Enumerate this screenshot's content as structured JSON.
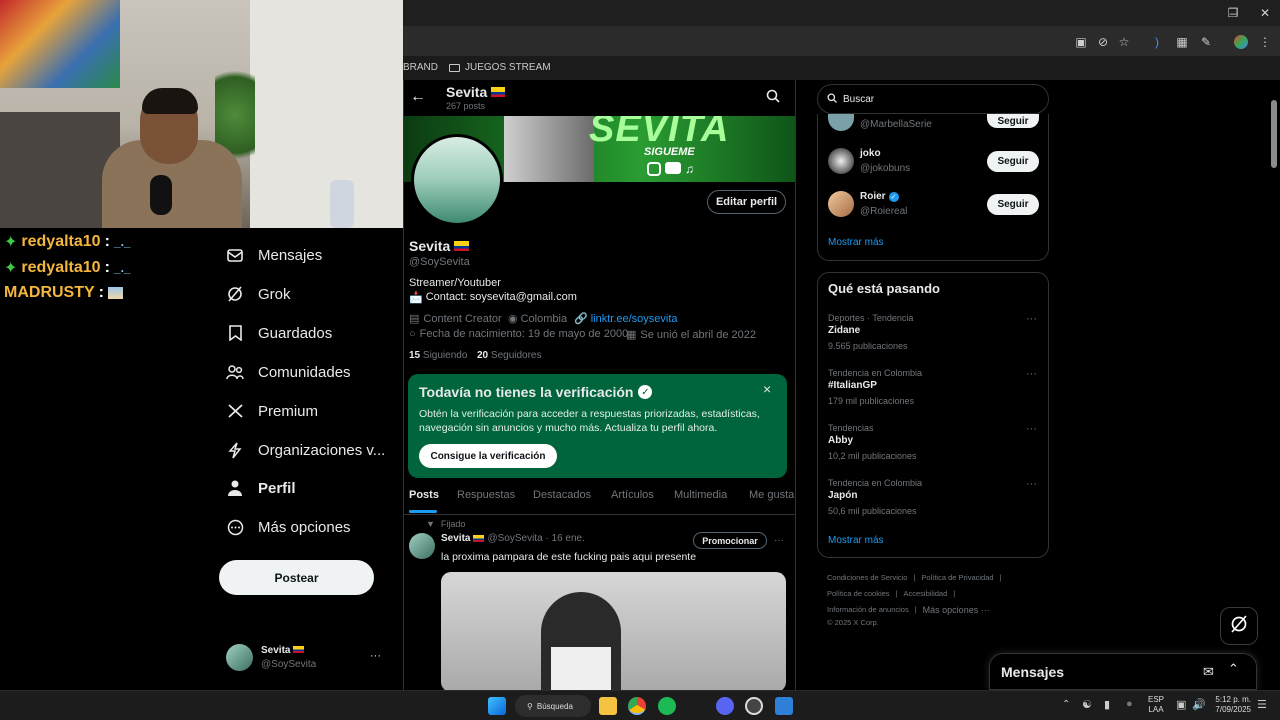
{
  "browser": {
    "bookmarks": [
      {
        "label": "BRAND"
      },
      {
        "label": "JUEGOS STREAM"
      }
    ]
  },
  "chat": [
    {
      "user": "redyalta10",
      "sep": ":",
      "msg": "_._",
      "color": "#f4b63f"
    },
    {
      "user": "redyalta10",
      "sep": ":",
      "msg": "_._",
      "color": "#f4b63f"
    },
    {
      "user": "MADRUSTY",
      "sep": ":",
      "msg": "",
      "color": "#f4b63f"
    }
  ],
  "nav": {
    "items": [
      {
        "label": "Mensajes",
        "icon": "mail-icon"
      },
      {
        "label": "Grok",
        "icon": "grok-icon"
      },
      {
        "label": "Guardados",
        "icon": "bookmark-icon"
      },
      {
        "label": "Comunidades",
        "icon": "communities-icon"
      },
      {
        "label": "Premium",
        "icon": "x-logo-icon"
      },
      {
        "label": "Organizaciones v...",
        "icon": "lightning-icon"
      },
      {
        "label": "Perfil",
        "icon": "person-icon"
      },
      {
        "label": "Más opciones",
        "icon": "more-circle-icon"
      }
    ],
    "post_label": "Postear",
    "account": {
      "name": "Sevita",
      "handle": "@SoySevita",
      "more": "···"
    }
  },
  "profile": {
    "header_name": "Sevita",
    "posts_count": "267 posts",
    "banner_text": "SEVITA",
    "banner_sub": "SIGUEME",
    "edit_label": "Editar perfil",
    "name": "Sevita",
    "handle": "@SoySevita",
    "bio_line1": "Streamer/Youtuber",
    "bio_line2": "Contact: soysevita@gmail.com",
    "category": "Content Creator",
    "location": "Colombia",
    "link": "linktr.ee/soysevita",
    "birth": "Fecha de nacimiento: 19 de mayo de 2000",
    "joined": "Se unió el abril de 2022",
    "following_count": "15",
    "following_label": "Siguiendo",
    "followers_count": "20",
    "followers_label": "Seguidores"
  },
  "verify_card": {
    "title": "Todavía no tienes la verificación",
    "body": "Obtén la verificación para acceder a respuestas priorizadas, estadísticas, navegación sin anuncios y mucho más. Actualiza tu perfil ahora.",
    "button": "Consigue la verificación",
    "close": "×",
    "bg_color": "#00643c"
  },
  "tabs": [
    "Posts",
    "Respuestas",
    "Destacados",
    "Artículos",
    "Multimedia",
    "Me gusta"
  ],
  "post": {
    "pinned": "Fijado",
    "name": "Sevita",
    "handle_time": "@SoySevita · 16 ene.",
    "promote": "Promocionar",
    "more": "···",
    "text": "la proxima pampara de este fucking pais aqui presente"
  },
  "search": {
    "placeholder": "Buscar"
  },
  "who_to_follow": {
    "users": [
      {
        "name": "",
        "handle": "@MarbellaSerie",
        "button": "Seguir"
      },
      {
        "name": "joko",
        "handle": "@jokobuns",
        "button": "Seguir"
      },
      {
        "name": "Roier",
        "handle": "@Roiereal",
        "button": "Seguir"
      }
    ],
    "show_more": "Mostrar más"
  },
  "trends": {
    "title": "Qué está pasando",
    "items": [
      {
        "context": "Deportes · Tendencia",
        "name": "Zidane",
        "count": "9.565 publicaciones"
      },
      {
        "context": "Tendencia en Colombia",
        "name": "#ItalianGP",
        "count": "179 mil publicaciones"
      },
      {
        "context": "Tendencias",
        "name": "Abby",
        "count": "10,2 mil publicaciones"
      },
      {
        "context": "Tendencia en Colombia",
        "name": "Japón",
        "count": "50,6 mil publicaciones"
      }
    ],
    "show_more": "Mostrar más"
  },
  "footer": {
    "line1": [
      "Condiciones de Servicio",
      "|",
      "Política de Privacidad",
      "|"
    ],
    "line2": [
      "Política de cookies",
      "|",
      "Accesibilidad",
      "|"
    ],
    "line3": [
      "Información de anuncios",
      "|",
      "Más opciones ···"
    ],
    "copyright": "© 2025 X Corp."
  },
  "messages_drawer": {
    "title": "Mensajes"
  },
  "taskbar": {
    "search": "Búsqueda",
    "lang1": "ESP",
    "lang2": "LAA",
    "time": "5:12 p. m.",
    "date": "7/09/2025"
  },
  "colors": {
    "accent": "#1d9bf0",
    "verify_green": "#00643c"
  }
}
